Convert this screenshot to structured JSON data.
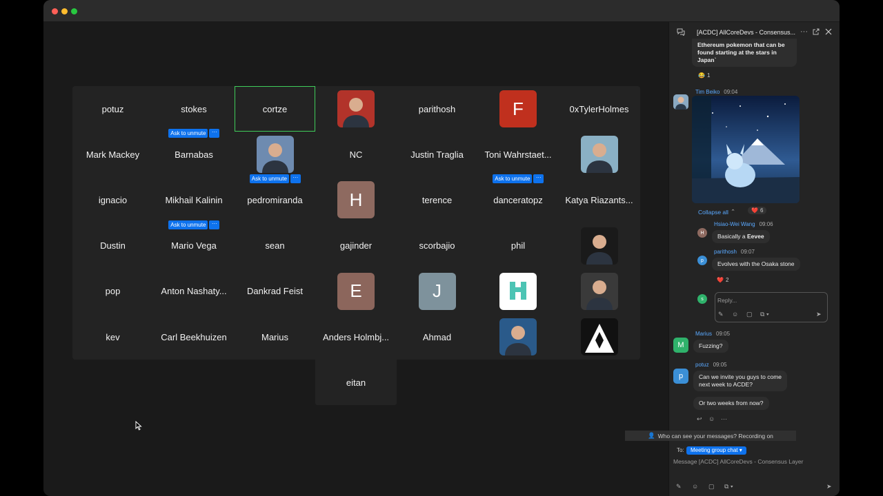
{
  "window": {
    "traffic_lights": [
      "#ff5f57",
      "#febc2e",
      "#28c840"
    ]
  },
  "grid": {
    "rows": [
      [
        "potuz",
        "stokes",
        "cortze",
        "",
        "parithosh",
        "F",
        "0xTylerHolmes"
      ],
      [
        "Mark Mackey",
        "Barnabas",
        "",
        "NC",
        "Justin Traglia",
        "Toni Wahrstaet...",
        ""
      ],
      [
        "ignacio",
        "Mikhail Kalinin",
        "pedromiranda",
        "H",
        "terence",
        "danceratopz",
        "Katya Riazants..."
      ],
      [
        "Dustin",
        "Mario Vega",
        "sean",
        "gajinder",
        "scorbajio",
        "phil",
        ""
      ],
      [
        "pop",
        "Anton Nashaty...",
        "Dankrad Feist",
        "E",
        "J",
        "",
        ""
      ],
      [
        "kev",
        "Carl Beekhuizen",
        "Marius",
        "Anders Holmbj...",
        "Ahmad",
        "",
        ""
      ]
    ],
    "extra_tile": "eitan",
    "ask_to_unmute": "Ask to unmute",
    "more_label": "···",
    "letter_colors": {
      "F": "#c0301e",
      "H": "#8e6a60",
      "E": "#8c665c",
      "J": "#7e929c"
    }
  },
  "chat": {
    "title": "[ACDC] AllCoreDevs - Consensus...",
    "top_message": "Ethereum pokemon that can be found starting at the stars in Japan`",
    "top_reaction": {
      "emoji": "😂",
      "count": "1"
    },
    "tim": {
      "name": "Tim Beiko",
      "time": "09:04"
    },
    "collapse_label": "Collapse all",
    "image_reaction": {
      "emoji": "❤️",
      "count": "6"
    },
    "replies": [
      {
        "avatar": "H",
        "avatar_color": "#8e6a60",
        "name": "Hsiao-Wei Wang",
        "time": "09:06",
        "text_prefix": "Basically a ",
        "text_bold": "Eevee"
      },
      {
        "avatar": "p",
        "avatar_color": "#3b8fd6",
        "name": "parithosh",
        "time": "09:07",
        "text": "Evolves with the Osaka stone"
      }
    ],
    "reply_reaction": {
      "emoji": "❤️",
      "count": "2"
    },
    "reply_placeholder": "Reply...",
    "reply_avatar": "s",
    "marius": {
      "avatar": "M",
      "name": "Marius",
      "time": "09:05",
      "text": "Fuzzing?"
    },
    "potuz": {
      "avatar": "p",
      "name": "potuz",
      "time": "09:05",
      "text1": "Can we invite you guys to come next week to ACDE?",
      "text2": "Or two weeks from now?"
    },
    "who_can_see": "Who can see your messages? Recording on",
    "to_label": "To:",
    "to_chip": "Meeting group chat ▾",
    "message_placeholder": "Message [ACDC] AllCoreDevs - Consensus Layer"
  }
}
